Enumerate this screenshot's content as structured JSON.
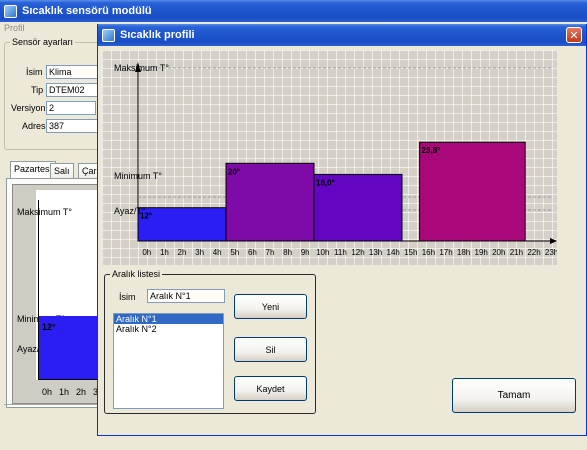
{
  "main_window": {
    "title": "Sıcaklık sensörü modülü",
    "menu": "Profil",
    "sensor_group": "Sensör ayarları",
    "fields": [
      {
        "label": "İsim",
        "value": "Klima"
      },
      {
        "label": "Tip",
        "value": "DTEM02"
      },
      {
        "label": "Versiyon",
        "value": "2"
      },
      {
        "label": "Adres",
        "value": "387"
      }
    ],
    "tabs": [
      "Pazartesi",
      "Salı",
      "Çarş"
    ],
    "mini_chart": {
      "max_label": "Maksimum T°",
      "min_label": "Minimum T°",
      "frost_label": "Ayaz/T°",
      "bar_value": "12°",
      "hours": [
        "0h",
        "1h",
        "2h",
        "3"
      ]
    }
  },
  "dialog": {
    "title": "Sıcaklık profili",
    "close_glyph": "✕",
    "chart_labels": {
      "max": "Maksimum T°",
      "min": "Minimum T°",
      "frost": "Ayaz/T°"
    },
    "range_group": "Aralık listesi",
    "name_label": "İsim",
    "name_value": "Aralık N°1",
    "ranges": [
      "Aralık N°1",
      "Aralık N°2"
    ],
    "buttons": {
      "new": "Yeni",
      "delete": "Sil",
      "save": "Kaydet",
      "ok": "Tamam"
    }
  },
  "colors": {
    "title_bar": "#1c54cc",
    "bar_blue": "#2a1ef5",
    "bar_purple": "#7e0aa8",
    "bar_violet": "#6206c4",
    "bar_magenta": "#a8087a",
    "grid_bg": "#d4d0c8"
  },
  "chart_data": {
    "type": "bar",
    "x_ticks": [
      "0h",
      "1h",
      "2h",
      "3h",
      "4h",
      "5h",
      "6h",
      "7h",
      "8h",
      "9h",
      "10h",
      "11h",
      "12h",
      "13h",
      "14h",
      "15h",
      "16h",
      "17h",
      "18h",
      "19h",
      "20h",
      "21h",
      "22h",
      "23h"
    ],
    "y_levels": [
      "Ayaz/T°",
      "Minimum T°",
      "Maksimum T°"
    ],
    "segments": [
      {
        "start_hour": 0,
        "end_hour": 5,
        "value": 12,
        "label": "12°",
        "color": "#2a1ef5"
      },
      {
        "start_hour": 5,
        "end_hour": 10,
        "value": 20,
        "label": "20°",
        "color": "#7e0aa8"
      },
      {
        "start_hour": 10,
        "end_hour": 15,
        "value": 18.0,
        "label": "18,0°",
        "color": "#6206c4"
      },
      {
        "start_hour": 16,
        "end_hour": 22,
        "value": 23.8,
        "label": "23,8°",
        "color": "#a8087a"
      }
    ],
    "grid": true
  }
}
